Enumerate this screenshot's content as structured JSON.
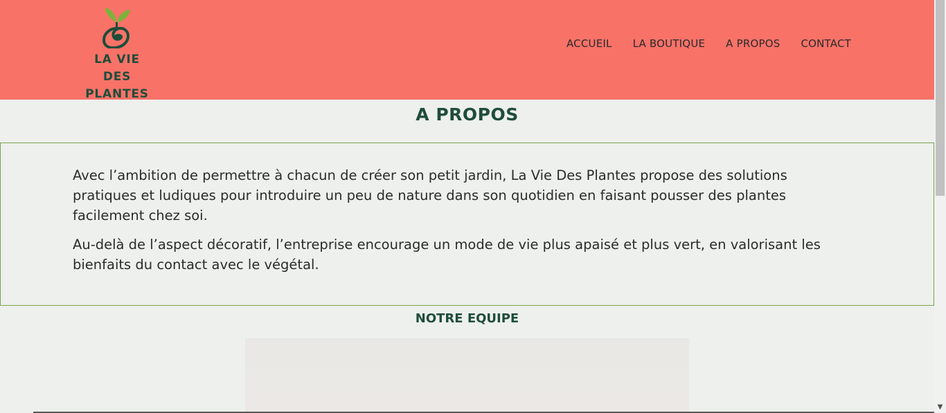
{
  "brand": {
    "line1": "LA VIE DES",
    "line2": "PLANTES",
    "colors": {
      "header_bg": "#f87268",
      "green": "#1f4d3a",
      "leaf": "#7bb33a",
      "page_bg": "#edf0ec"
    }
  },
  "nav": {
    "items": [
      {
        "label": "ACCUEIL"
      },
      {
        "label": "LA BOUTIQUE"
      },
      {
        "label": "A PROPOS"
      },
      {
        "label": "CONTACT"
      }
    ]
  },
  "about": {
    "title": "A PROPOS",
    "paragraph1": "Avec l’ambition de permettre à chacun de créer son petit jardin, La Vie Des Plantes propose des solutions pratiques et ludiques pour introduire un peu de nature dans son quotidien en faisant pousser des plantes facilement chez soi.",
    "paragraph2": "Au-delà de l’aspect décoratif, l’entreprise encourage un mode de vie plus apaisé et plus vert, en valorisant les bienfaits du contact avec le végétal."
  },
  "team": {
    "title": "NOTRE EQUIPE"
  },
  "scrollbar": {
    "down_arrow_icon": "chevron-down-icon",
    "arrow_glyph": "▼"
  }
}
